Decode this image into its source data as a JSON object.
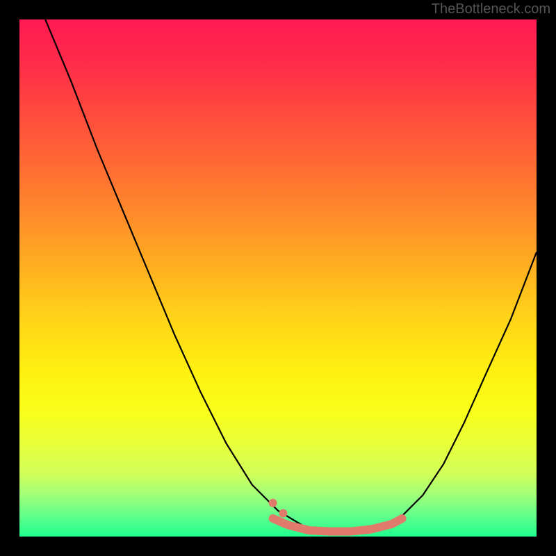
{
  "watermark": "TheBottleneck.com",
  "chart_data": {
    "type": "line",
    "title": "",
    "xlabel": "",
    "ylabel": "",
    "xlim": [
      0,
      100
    ],
    "ylim": [
      0,
      100
    ],
    "series": [
      {
        "name": "curve",
        "color": "#000000",
        "x": [
          5,
          10,
          15,
          20,
          25,
          30,
          35,
          40,
          45,
          50,
          55,
          58,
          62,
          66,
          70,
          74,
          78,
          82,
          86,
          90,
          95,
          100
        ],
        "y": [
          100,
          88,
          75,
          63,
          51,
          39,
          28,
          18,
          10,
          5,
          2,
          1,
          1,
          1,
          2,
          4,
          8,
          14,
          22,
          31,
          42,
          55
        ]
      }
    ],
    "markers": {
      "name": "highlight-dots",
      "color": "#e07a6a",
      "x": [
        49,
        52,
        56,
        60,
        64,
        68,
        72,
        74
      ],
      "y": [
        3.5,
        2.2,
        1.2,
        1.0,
        1.0,
        1.4,
        2.4,
        3.5
      ]
    },
    "gradient_stops": [
      {
        "pos": 0,
        "color": "#ff1a52"
      },
      {
        "pos": 50,
        "color": "#ffd418"
      },
      {
        "pos": 100,
        "color": "#20ff90"
      }
    ]
  }
}
